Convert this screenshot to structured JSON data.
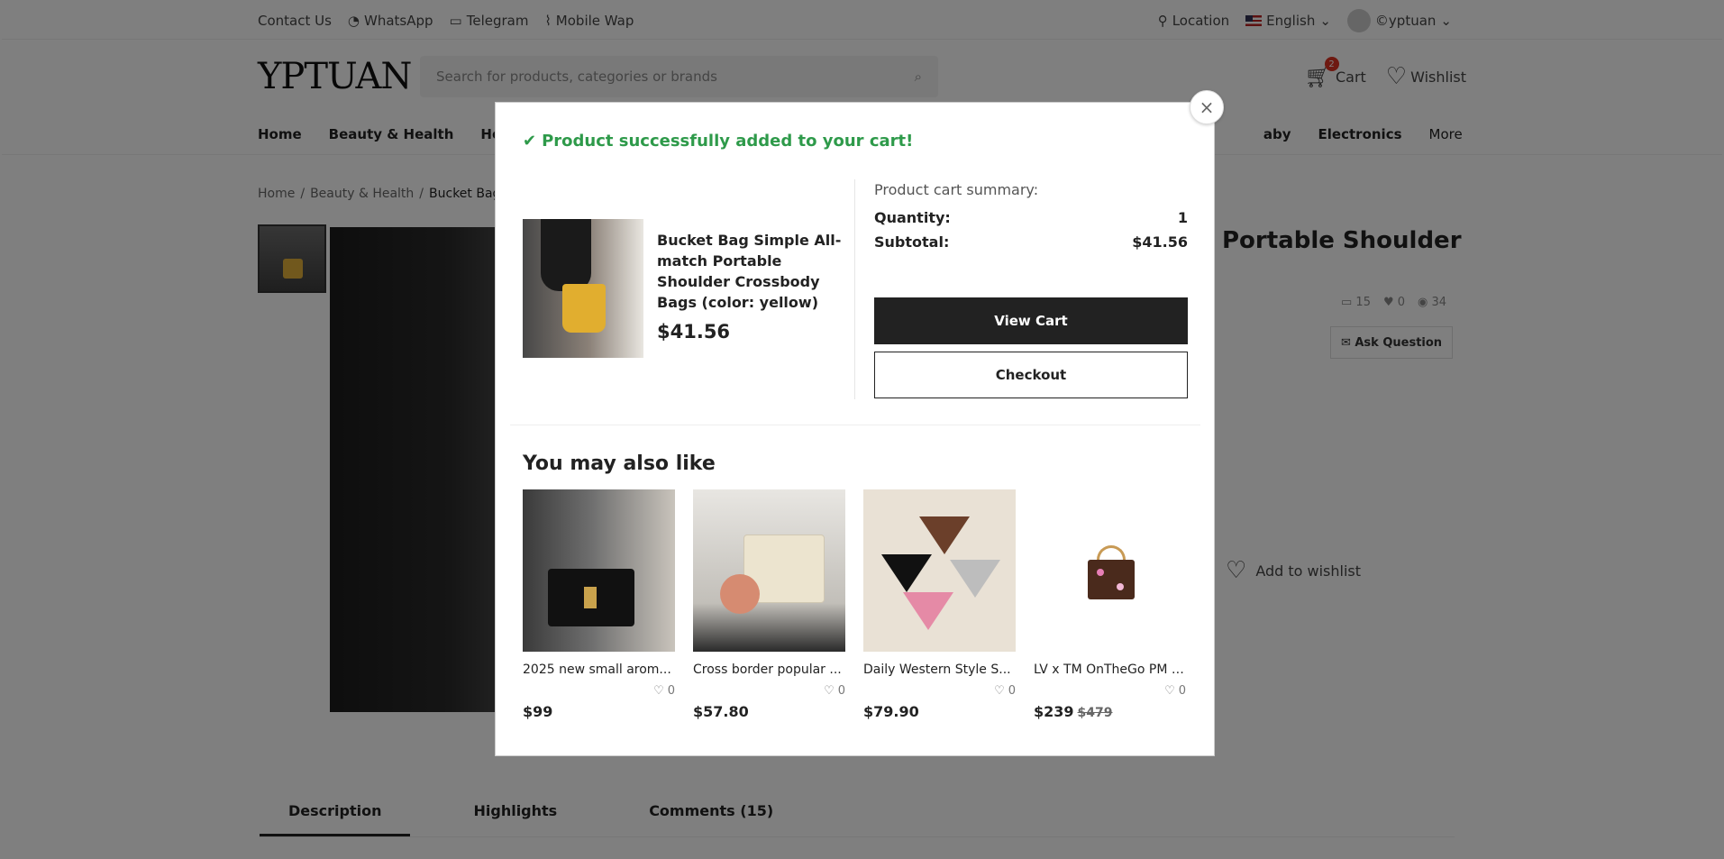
{
  "topbar": {
    "contact": "Contact Us",
    "whatsapp": "WhatsApp",
    "telegram": "Telegram",
    "mobile": "Mobile Wap",
    "location": "Location",
    "language": "English",
    "user": "©yptuan"
  },
  "header": {
    "logo": "YPTUAN",
    "search_placeholder": "Search for products, categories or brands",
    "cart_label": "Cart",
    "cart_count": "2",
    "wishlist_label": "Wishlist"
  },
  "nav": {
    "items": [
      "Home",
      "Beauty & Health",
      "Hom",
      "aby",
      "Electronics",
      "More"
    ]
  },
  "breadcrumb": [
    "Home",
    "/",
    "Beauty & Health",
    "/",
    "Bucket Bag S"
  ],
  "product_page": {
    "title_fragment": "Portable Shoulder",
    "comments": "15",
    "likes": "0",
    "views": "34",
    "ask_question": "Ask Question",
    "add_to_wishlist": "Add to wishlist"
  },
  "tabs": [
    "Description",
    "Highlights",
    "Comments (15)"
  ],
  "modal": {
    "success_message": "Product successfully added to your cart!",
    "product_name": "Bucket Bag Simple All-match Portable Shoulder Crossbody Bags (color: yellow)",
    "product_price": "$41.56",
    "summary_title": "Product cart summary:",
    "quantity_label": "Quantity:",
    "quantity_value": "1",
    "subtotal_label": "Subtotal:",
    "subtotal_value": "$41.56",
    "view_cart": "View Cart",
    "checkout": "Checkout",
    "also_like_title": "You may also like",
    "recommendations": [
      {
        "name": "2025 new small arom...",
        "likes": "0",
        "price": "$99",
        "old_price": ""
      },
      {
        "name": "Cross border popular ...",
        "likes": "0",
        "price": "$57.80",
        "old_price": ""
      },
      {
        "name": "Daily Western Style S...",
        "likes": "0",
        "price": "$79.90",
        "old_price": ""
      },
      {
        "name": "LV x TM OnTheGo PM (...",
        "likes": "0",
        "price": "$239",
        "old_price": "$479"
      }
    ]
  },
  "colors": {
    "success": "#2e9a4a",
    "dark_button": "#222222",
    "cart_badge": "#dd3322"
  }
}
